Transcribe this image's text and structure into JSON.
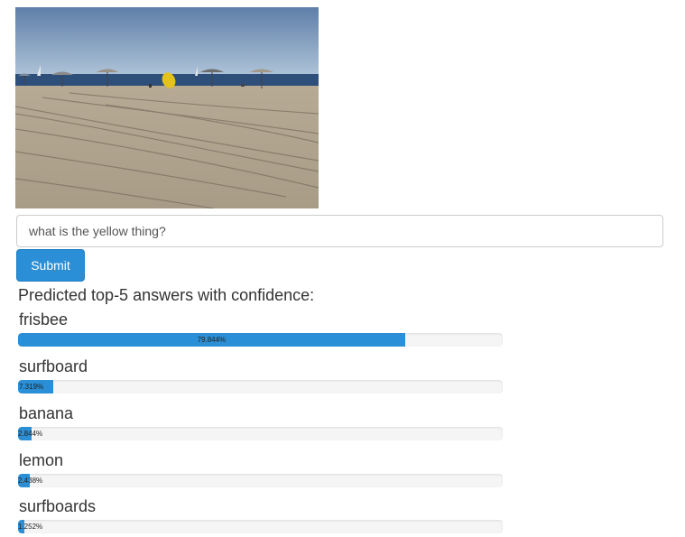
{
  "question": {
    "value": "what is the yellow thing?"
  },
  "submit_label": "Submit",
  "results_heading": "Predicted top-5 answers with confidence:",
  "accent_color": "#2a8fd6",
  "answers": [
    {
      "label": "frisbee",
      "confidence_text": "79.844%",
      "confidence": 79.844
    },
    {
      "label": "surfboard",
      "confidence_text": "7.319%",
      "confidence": 7.319
    },
    {
      "label": "banana",
      "confidence_text": "2.844%",
      "confidence": 2.844
    },
    {
      "label": "lemon",
      "confidence_text": "2.438%",
      "confidence": 2.438
    },
    {
      "label": "surfboards",
      "confidence_text": "1.252%",
      "confidence": 1.252
    }
  ]
}
